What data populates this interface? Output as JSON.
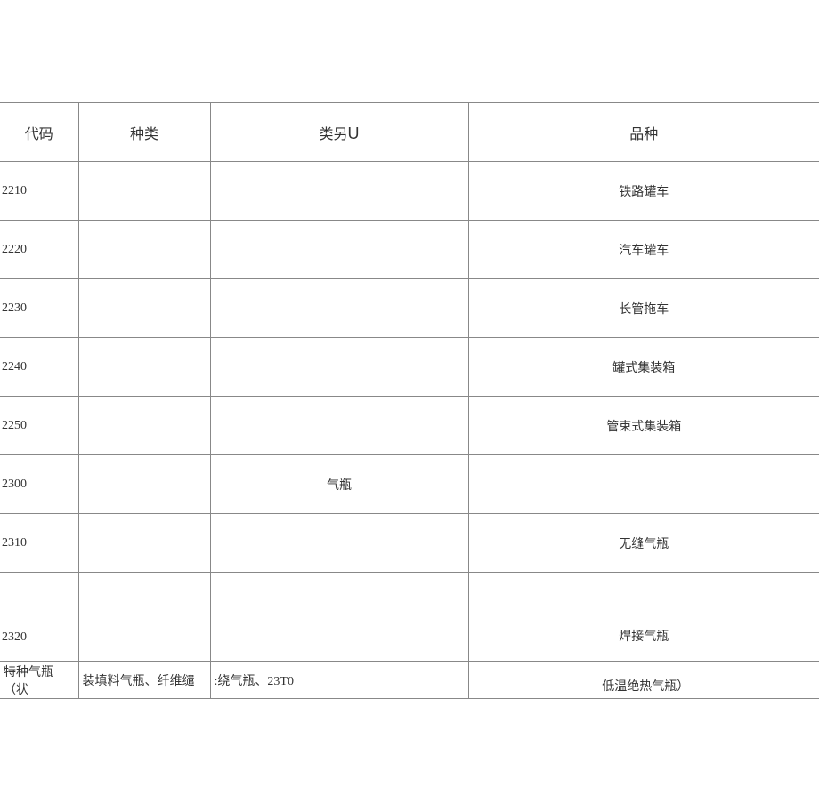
{
  "headers": {
    "code": "代码",
    "kind": "种类",
    "category_prefix": "类另",
    "category_u": "U",
    "variety": "品种"
  },
  "rows": [
    {
      "code": "2210",
      "kind": "",
      "category": "",
      "variety": "铁路罐车"
    },
    {
      "code": "2220",
      "kind": "",
      "category": "",
      "variety": "汽车罐车"
    },
    {
      "code": "2230",
      "kind": "",
      "category": "",
      "variety": "长管拖车"
    },
    {
      "code": "2240",
      "kind": "",
      "category": "",
      "variety": "罐式集装箱"
    },
    {
      "code": "2250",
      "kind": "",
      "category": "",
      "variety": "管束式集装箱"
    },
    {
      "code": "2300",
      "kind": "",
      "category": "气瓶",
      "variety": ""
    },
    {
      "code": "2310",
      "kind": "",
      "category": "",
      "variety": "无缝气瓶"
    },
    {
      "code": "2320",
      "kind": "",
      "category": "",
      "variety": "焊接气瓶"
    }
  ],
  "footer": {
    "c1": "特种气瓶（状",
    "c2": "装填料气瓶、纤维缱",
    "c3": ":绕气瓶、23T0",
    "c4": "低温绝热气瓶）"
  }
}
